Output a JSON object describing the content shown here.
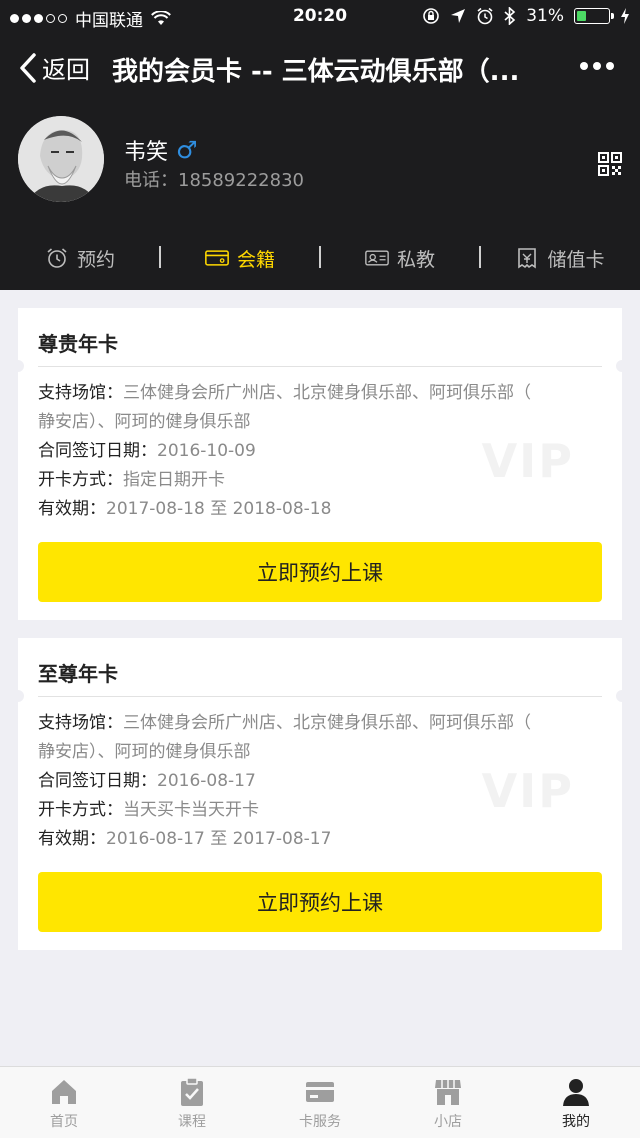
{
  "status_bar": {
    "carrier": "中国联通",
    "time": "20:20",
    "battery": "31%",
    "battery_level": 0.31
  },
  "nav": {
    "back_label": "返回",
    "title": "我的会员卡 -- 三体云动俱乐部（..."
  },
  "profile": {
    "name": "韦笑",
    "gender_symbol": "♂",
    "phone_label": "电话：",
    "phone": "18589222830"
  },
  "tabs": [
    {
      "label": "预约",
      "icon": "alarm-clock-icon"
    },
    {
      "label": "会籍",
      "icon": "membership-card-icon"
    },
    {
      "label": "私教",
      "icon": "id-card-icon"
    },
    {
      "label": "储值卡",
      "icon": "voucher-icon"
    }
  ],
  "active_tab": "会籍",
  "cards": [
    {
      "title": "尊贵年卡",
      "venues_label": "支持场馆：",
      "venues_line1": "三体健身会所广州店、北京健身俱乐部、阿珂俱乐部（",
      "venues_line2": "静安店）、阿珂的健身俱乐部",
      "sign_label": "合同签订日期：",
      "sign_date": "2016-10-09",
      "open_label": "开卡方式：",
      "open_method": "指定日期开卡",
      "valid_label": "有效期：",
      "valid_range": "2017-08-18 至 2018-08-18",
      "watermark": "VIP",
      "button": "立即预约上课"
    },
    {
      "title": "至尊年卡",
      "venues_label": "支持场馆：",
      "venues_line1": "三体健身会所广州店、北京健身俱乐部、阿珂俱乐部（",
      "venues_line2": "静安店）、阿珂的健身俱乐部",
      "sign_label": "合同签订日期：",
      "sign_date": "2016-08-17",
      "open_label": "开卡方式：",
      "open_method": "当天买卡当天开卡",
      "valid_label": "有效期：",
      "valid_range": "2016-08-17 至 2017-08-17",
      "watermark": "VIP",
      "button": "立即预约上课"
    }
  ],
  "tabbar": [
    {
      "label": "首页",
      "icon": "home-icon"
    },
    {
      "label": "课程",
      "icon": "clipboard-icon"
    },
    {
      "label": "卡服务",
      "icon": "card-icon"
    },
    {
      "label": "小店",
      "icon": "shop-icon"
    },
    {
      "label": "我的",
      "icon": "person-icon"
    }
  ],
  "colors": {
    "header_bg": "#1c1c1e",
    "accent": "#ffe600",
    "active_tab": "#ffd800",
    "gender": "#2f8ee0"
  }
}
